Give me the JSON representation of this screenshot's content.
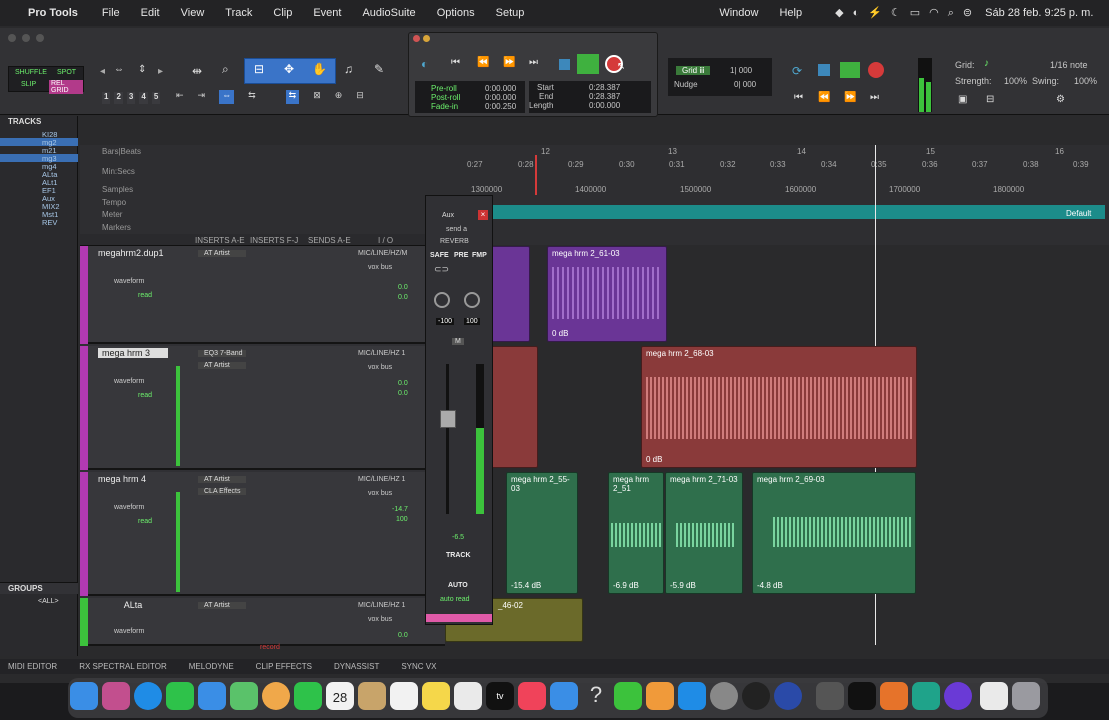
{
  "menubar": {
    "apple": "",
    "app": "Pro Tools",
    "items": [
      "File",
      "Edit",
      "View",
      "Track",
      "Clip",
      "Event",
      "AudioSuite",
      "Options",
      "Setup",
      "Window",
      "Help"
    ],
    "clock": "Sáb 28 feb.  9:25 p. m."
  },
  "toolbar": {
    "modes": [
      "SHUFFLE",
      "SPOT",
      "SLIP",
      "REL GRID"
    ],
    "zoom_presets": [
      "1",
      "2",
      "3",
      "4",
      "5"
    ],
    "grid_label": "Grid:",
    "grid_value": "1/16 note",
    "strength_label": "Strength:",
    "strength_value": "100%",
    "swing_label": "Swing:",
    "swing_value": "100%",
    "grid_counter": "1| 000",
    "nudge_label": "Nudge",
    "nudge_value": "0| 000"
  },
  "transport": {
    "preroll_label": "Pre-roll",
    "preroll_value": "0:00.000",
    "postroll_label": "Post-roll",
    "postroll_value": "0:00.000",
    "fadein_label": "Fade-in",
    "fadein_value": "0:00.250",
    "start_label": "Start",
    "start_value": "0:28.387",
    "end_label": "End",
    "end_value": "0:28.387",
    "length_label": "Length",
    "length_value": "0:00.000"
  },
  "sidebar": {
    "tracks_title": "TRACKS",
    "track_list": [
      "KI28",
      "mg2",
      "m21",
      "mg3",
      "mg4",
      "ALta",
      "ALt1",
      "EF1",
      "Aux",
      "MIX2",
      "Mst1",
      "REV"
    ],
    "groups_title": "GROUPS",
    "groups_all": "<ALL>"
  },
  "rulers": {
    "labels": [
      "Bars|Beats",
      "Min:Secs",
      "Samples",
      "Tempo",
      "Meter",
      "Markers"
    ],
    "bars": [
      "12",
      "13",
      "14",
      "15",
      "16"
    ],
    "mins": [
      "0:27",
      "0:28",
      "0:29",
      "0:30",
      "0:31",
      "0:32",
      "0:33",
      "0:34",
      "0:35",
      "0:36",
      "0:37",
      "0:38",
      "0:39"
    ],
    "samples": [
      "1300000",
      "1400000",
      "1500000",
      "1600000",
      "1700000",
      "1800000"
    ],
    "meter_default": "Default"
  },
  "edit_columns": [
    "INSERTS A-E",
    "INSERTS F-J",
    "SENDS A-E",
    "I / O"
  ],
  "tracks": [
    {
      "name": "megahrm2.dup1",
      "io": "MIC/LINE/HZ/M",
      "bus": "vox bus",
      "vol": "0.0",
      "pan": "0.0",
      "insert": "AT Artist",
      "view": "waveform",
      "auto": "read"
    },
    {
      "name": "mega hrm 3",
      "io": "MIC/LINE/HZ 1",
      "bus": "vox bus",
      "vol": "0.0",
      "pan": "0.0",
      "insert": "EQ3 7-Band",
      "insert2": "AT Artist",
      "view": "waveform",
      "auto": "read"
    },
    {
      "name": "mega hrm 4",
      "io": "MIC/LINE/HZ 1",
      "bus": "vox bus",
      "vol": "-14.7",
      "pan": "100",
      "insert": "AT Artist",
      "insert2": "CLA Effects",
      "view": "waveform",
      "auto": "read"
    },
    {
      "name": "ALta",
      "io": "MIC/LINE/HZ 1",
      "bus": "vox bus",
      "vol": "0.0",
      "insert": "AT Artist",
      "view": "waveform",
      "auto": "record"
    }
  ],
  "clips": [
    {
      "name": "mega hrm 2_61-03",
      "gain": "0 dB"
    },
    {
      "name": "mega hrm 2_68-03",
      "gain": "0 dB"
    },
    {
      "name": "mega hrm 2_55-03",
      "gain": "-15.4 dB"
    },
    {
      "name": "mega hrm 2_51",
      "gain": "-6.9 dB"
    },
    {
      "name": "mega hrm 2_71-03",
      "gain": "-5.9 dB"
    },
    {
      "name": "mega hrm 2_69-03",
      "gain": "-4.8 dB"
    },
    {
      "name": "_46-02",
      "gain": ""
    }
  ],
  "mixer": {
    "name": "Aux",
    "send": "send a",
    "bus": "REVERB",
    "safe": "SAFE",
    "pre": "PRE",
    "fmp": "FMP",
    "pan_l": "-100",
    "pan_r": "100",
    "m": "M",
    "fader": "-6.5",
    "track": "TRACK",
    "auto": "AUTO",
    "auto_mode": "auto read"
  },
  "bottombar": [
    "MIDI EDITOR",
    "RX SPECTRAL EDITOR",
    "MELODYNE",
    "CLIP EFFECTS",
    "DYNASSIST",
    "SYNC VX"
  ],
  "dock": {
    "calendar_day": "28"
  }
}
